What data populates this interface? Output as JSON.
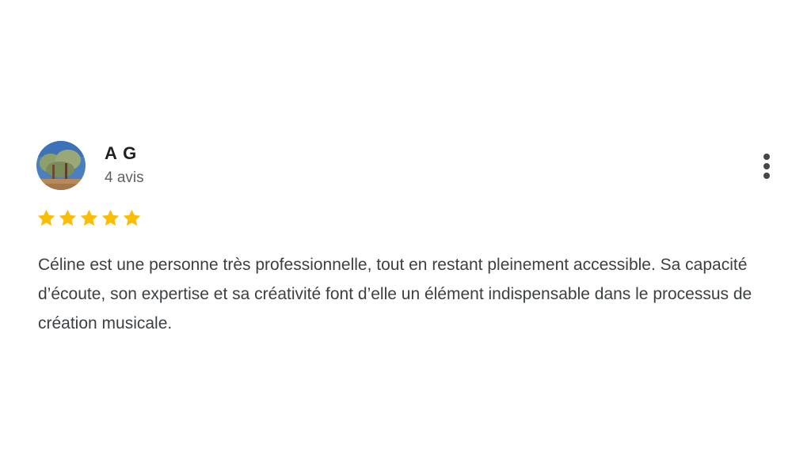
{
  "review": {
    "author_name": "A G",
    "review_count": "4 avis",
    "rating": 5,
    "rating_max": 5,
    "text": "Céline est une personne très professionnelle, tout en restant pleinement accessible. Sa capacité d’écoute, son expertise et sa créativité font d’elle un élément indispensable dans le processus de création musicale."
  },
  "icons": {
    "avatar": "avatar-photo-trees",
    "menu": "more-vert-icon",
    "star": "star-icon"
  },
  "colors": {
    "star": "#FBBC04",
    "name": "#202124",
    "secondary_text": "#5f6368",
    "body_text": "#3c4043"
  }
}
